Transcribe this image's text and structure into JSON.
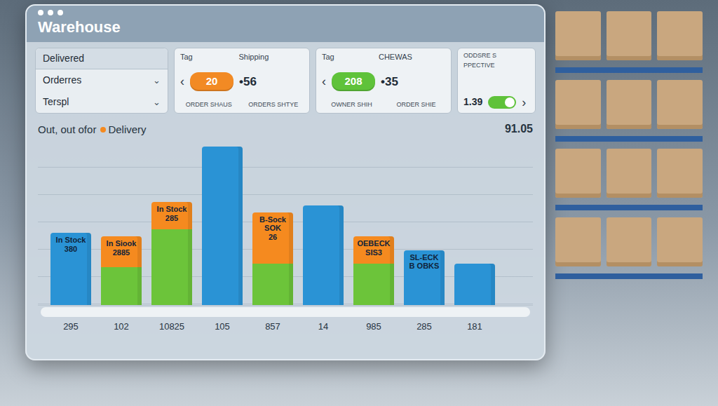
{
  "window": {
    "title": "Warehouse"
  },
  "filter": {
    "title": "Delivered",
    "items": [
      {
        "label": "Orderres",
        "chevron": "⌄"
      },
      {
        "label": "Terspl",
        "chevron": "⌄"
      }
    ]
  },
  "cards": [
    {
      "kind": "pill",
      "tag": "Tag",
      "title": "Shipping",
      "arrow": "‹",
      "pill": "20",
      "color": "#f28a24",
      "reading": "•56",
      "captions": [
        "ORDER SHAUS",
        "ORDERS SHTYE"
      ]
    },
    {
      "kind": "pill",
      "tag": "Tag",
      "title": "CHEWAS",
      "arrow": "‹",
      "pill": "208",
      "color": "#5fc23a",
      "reading": "•35",
      "captions": [
        "OWNER SHIH",
        "ORDER SHIE"
      ]
    },
    {
      "kind": "switch",
      "title": "ODDSRE S PPECTIVE",
      "value": "1.39",
      "arrow": "›",
      "on": true,
      "color": "#5fc23a"
    }
  ],
  "chart": {
    "title": "Out, out ofor",
    "legend": [
      {
        "label": "Delivery",
        "color": "#f58a1f"
      }
    ],
    "reading": "91.05",
    "series": [
      {
        "color": "#2a93d5",
        "values": [
          105,
          0,
          0,
          230,
          0,
          145,
          0,
          80,
          60
        ]
      },
      {
        "color": "#6cc43a",
        "values": [
          0,
          55,
          110,
          0,
          60,
          0,
          60,
          0,
          0
        ]
      },
      {
        "color": "#f58a1f",
        "values": [
          0,
          45,
          40,
          0,
          75,
          0,
          40,
          0,
          0
        ]
      }
    ],
    "bars": [
      {
        "tick": "295",
        "label": [
          "In Stock",
          "380"
        ]
      },
      {
        "tick": "102",
        "label": [
          "In Siook",
          "2885"
        ]
      },
      {
        "tick": "10825",
        "label": [
          "In Stock",
          "285"
        ]
      },
      {
        "tick": "105",
        "label": []
      },
      {
        "tick": "857",
        "label": [
          "B-Sock",
          "SOK",
          "26"
        ]
      },
      {
        "tick": "14",
        "label": []
      },
      {
        "tick": "985",
        "label": [
          "OEBECK",
          "SIS3"
        ]
      },
      {
        "tick": "285",
        "label": [
          "SL-ECK",
          "B OBKS"
        ]
      },
      {
        "tick": "181",
        "label": []
      }
    ]
  }
}
